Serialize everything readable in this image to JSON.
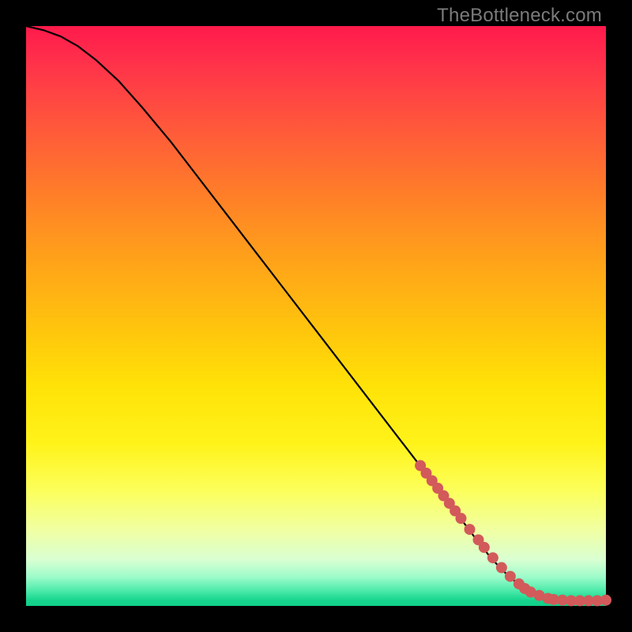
{
  "watermark": "TheBottleneck.com",
  "chart_data": {
    "type": "line",
    "title": "",
    "xlabel": "",
    "ylabel": "",
    "xlim": [
      0,
      100
    ],
    "ylim": [
      0,
      100
    ],
    "grid": false,
    "legend": false,
    "series": [
      {
        "name": "curve",
        "kind": "line",
        "x": [
          0,
          3,
          6,
          9,
          12,
          16,
          20,
          25,
          30,
          35,
          40,
          45,
          50,
          55,
          60,
          65,
          70,
          75,
          78,
          80,
          82,
          84,
          86,
          88,
          90,
          92,
          94,
          96,
          98,
          100
        ],
        "y": [
          100,
          99.3,
          98.2,
          96.5,
          94.2,
          90.5,
          86.0,
          80.0,
          73.5,
          67.0,
          60.5,
          54.0,
          47.5,
          41.0,
          34.5,
          28.0,
          21.5,
          15.0,
          11.0,
          8.5,
          6.3,
          4.5,
          3.0,
          2.0,
          1.3,
          1.0,
          0.9,
          0.9,
          0.9,
          1.0
        ]
      },
      {
        "name": "points",
        "kind": "scatter",
        "x": [
          68,
          69,
          70,
          71,
          72,
          73,
          74,
          75,
          76.5,
          78,
          79,
          80.5,
          82,
          83.5,
          85,
          86,
          87,
          88.5,
          90,
          91,
          92.5,
          94,
          95.5,
          97,
          98.5,
          100
        ],
        "y": [
          24.2,
          22.9,
          21.6,
          20.3,
          19.0,
          17.7,
          16.4,
          15.1,
          13.2,
          11.4,
          10.1,
          8.3,
          6.6,
          5.1,
          3.8,
          3.0,
          2.4,
          1.8,
          1.3,
          1.1,
          1.0,
          0.9,
          0.9,
          0.9,
          0.9,
          1.0
        ]
      }
    ]
  }
}
